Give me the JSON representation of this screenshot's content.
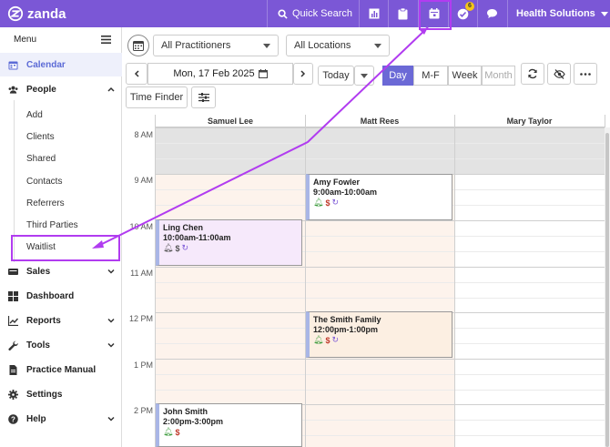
{
  "topbar": {
    "logo_text": "zanda",
    "quick_search": "Quick Search",
    "tasks_badge": "6",
    "org_name": "Health Solutions",
    "colors": {
      "bar": "#7b57d6",
      "highlight": "#b13cf0"
    }
  },
  "sidebar": {
    "menu_label": "Menu",
    "items": [
      {
        "label": "Calendar",
        "icon": "calendar-icon",
        "active": true
      },
      {
        "label": "People",
        "icon": "people-icon",
        "expanded": true
      },
      {
        "label": "Sales",
        "icon": "sales-icon"
      },
      {
        "label": "Dashboard",
        "icon": "dashboard-icon"
      },
      {
        "label": "Reports",
        "icon": "reports-icon"
      },
      {
        "label": "Tools",
        "icon": "tools-icon"
      },
      {
        "label": "Practice Manual",
        "icon": "manual-icon"
      },
      {
        "label": "Settings",
        "icon": "settings-icon"
      },
      {
        "label": "Help",
        "icon": "help-icon"
      }
    ],
    "people_sub": [
      "Add",
      "Clients",
      "Shared",
      "Contacts",
      "Referrers",
      "Third Parties",
      "Waitlist"
    ]
  },
  "toolbar": {
    "practitioners": "All Practitioners",
    "locations": "All Locations",
    "date": "Mon, 17 Feb 2025",
    "today": "Today",
    "views": [
      "Day",
      "M-F",
      "Week",
      "Month"
    ],
    "active_view": "Day",
    "time_finder": "Time Finder"
  },
  "calendar": {
    "columns": [
      "Samuel Lee",
      "Matt Rees",
      "Mary Taylor"
    ],
    "hours": [
      "8 AM",
      "9 AM",
      "10 AM",
      "11 AM",
      "12 PM",
      "1 PM",
      "2 PM"
    ],
    "appointments": [
      {
        "name": "Amy Fowler",
        "time": "9:00am-10:00am",
        "bg": "#ffffff"
      },
      {
        "name": "Ling Chen",
        "time": "10:00am-11:00am",
        "bg": "#f6e9fb"
      },
      {
        "name": "The Smith Family",
        "time": "12:00pm-1:00pm",
        "bg": "#fcefe2"
      },
      {
        "name": "John Smith",
        "time": "2:00pm-3:00pm",
        "bg": "#ffffff"
      }
    ]
  }
}
